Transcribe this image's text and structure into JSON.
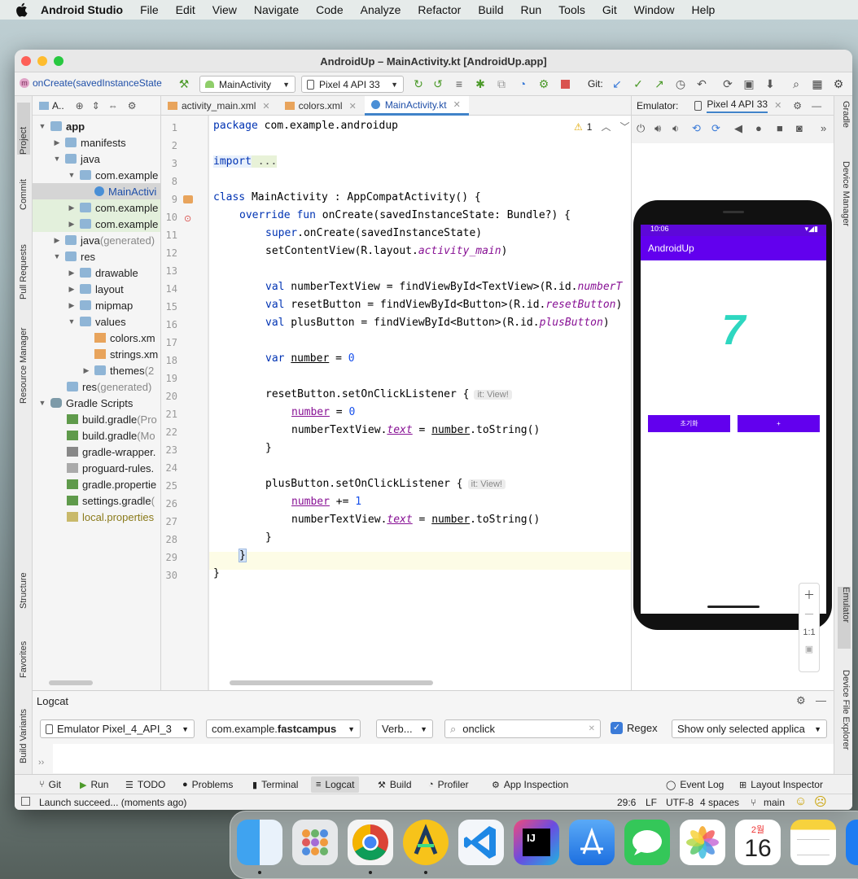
{
  "menubar": {
    "app_name": "Android Studio",
    "items": [
      "File",
      "Edit",
      "View",
      "Navigate",
      "Code",
      "Analyze",
      "Refactor",
      "Build",
      "Run",
      "Tools",
      "Git",
      "Window",
      "Help"
    ]
  },
  "window": {
    "title": "AndroidUp – MainActivity.kt [AndroidUp.app]"
  },
  "toolbar": {
    "breadcrumb": "onCreate(savedInstanceState",
    "run_config": "MainActivity",
    "device": "Pixel 4 API 33",
    "git_label": "Git:"
  },
  "left_stripe": [
    "Project",
    "Commit",
    "Pull Requests",
    "Resource Manager",
    "Structure",
    "Favorites",
    "Build Variants"
  ],
  "right_stripe": [
    "Gradle",
    "Device Manager",
    "Emulator",
    "Device File Explorer"
  ],
  "project": {
    "header": "A..",
    "tree": [
      {
        "label": "app",
        "bold": true
      },
      {
        "label": "manifests"
      },
      {
        "label": "java"
      },
      {
        "label": "com.example"
      },
      {
        "label": "MainActivi"
      },
      {
        "label": "com.example"
      },
      {
        "label": "com.example"
      },
      {
        "label": "java",
        "suffix": " (generated)"
      },
      {
        "label": "res"
      },
      {
        "label": "drawable"
      },
      {
        "label": "layout"
      },
      {
        "label": "mipmap"
      },
      {
        "label": "values"
      },
      {
        "label": "colors.xm"
      },
      {
        "label": "strings.xm"
      },
      {
        "label": "themes",
        "suffix": " (2"
      },
      {
        "label": "res",
        "suffix": " (generated)"
      },
      {
        "label": "Gradle Scripts"
      },
      {
        "label": "build.gradle",
        "suffix": " (Pro"
      },
      {
        "label": "build.gradle",
        "suffix": " (Mo"
      },
      {
        "label": "gradle-wrapper.",
        "suffix": ""
      },
      {
        "label": "proguard-rules.",
        "suffix": ""
      },
      {
        "label": "gradle.propertie",
        "suffix": ""
      },
      {
        "label": "settings.gradle",
        "suffix": " ("
      },
      {
        "label": "local.properties",
        "suffix": ""
      }
    ]
  },
  "editor": {
    "tabs": [
      "activity_main.xml",
      "colors.xml",
      "MainActivity.kt"
    ],
    "active_tab": "MainActivity.kt",
    "warning_count": "1",
    "line_numbers": [
      "1",
      "2",
      "3",
      "8",
      "9",
      "10",
      "11",
      "12",
      "13",
      "14",
      "15",
      "16",
      "17",
      "18",
      "19",
      "20",
      "21",
      "22",
      "23",
      "24",
      "25",
      "26",
      "27",
      "28",
      "29",
      "30"
    ],
    "hint": "it: View!",
    "code": {
      "l1_kw": "package",
      "l1_rest": " com.example.androidup",
      "l3_kw": "import",
      "l3_rest": " ...",
      "l9_kw": "class",
      "l9_rest": " MainActivity : AppCompatActivity() {",
      "l10_kw": "override fun",
      "l10_rest": " onCreate(savedInstanceState: Bundle?) {",
      "l11_kw": "super",
      "l11_rest": ".onCreate(savedInstanceState)",
      "l12_a": "setContentView(R.layout.",
      "l12_b": "activity_main",
      "l12_c": ")",
      "l14_kw": "val",
      "l14_a": " numberTextView = findViewById<TextView>(R.id.",
      "l14_b": "numberT",
      "l15_kw": "val",
      "l15_a": " resetButton = findViewById<Button>(R.id.",
      "l15_b": "resetButton",
      "l15_c": ")",
      "l16_kw": "val",
      "l16_a": " plusButton = findViewById<Button>(R.id.",
      "l16_b": "plusButton",
      "l16_c": ")",
      "l18_kw": "var",
      "l18_a": " ",
      "l18_b": "number",
      "l18_c": " = ",
      "l18_d": "0",
      "l20": "resetButton.setOnClickListener {",
      "l21_a": "number",
      "l21_b": " = ",
      "l21_c": "0",
      "l22_a": "numberTextView.",
      "l22_b": "text",
      "l22_c": " = ",
      "l22_d": "number",
      "l22_e": ".toString()",
      "l23": "}",
      "l25": "plusButton.setOnClickListener {",
      "l26_a": "number",
      "l26_b": " += ",
      "l26_c": "1",
      "l27_a": "numberTextView.",
      "l27_b": "text",
      "l27_c": " = ",
      "l27_d": "number",
      "l27_e": ".toString()",
      "l28": "}",
      "l29": "}",
      "l30": "}"
    }
  },
  "emulator": {
    "title": "Emulator:",
    "device_tab": "Pixel 4 API 33",
    "status_time": "10:06",
    "app_title": "AndroidUp",
    "number": "7",
    "reset_button": "초기화",
    "plus_button": "+",
    "zoom_ratio": "1:1"
  },
  "logcat": {
    "title": "Logcat",
    "device": "Emulator Pixel_4_API_3",
    "package_prefix": "com.example.",
    "package_bold": "fastcampus",
    "level": "Verb...",
    "search": "onclick",
    "regex_label": "Regex",
    "regex_checked": true,
    "filter": "Show only selected applica"
  },
  "bottom_tools": [
    "Git",
    "Run",
    "TODO",
    "Problems",
    "Terminal",
    "Logcat",
    "Build",
    "Profiler",
    "App Inspection",
    "Event Log",
    "Layout Inspector"
  ],
  "status": {
    "message": "Launch succeed... (moments ago)",
    "position": "29:6",
    "line_sep": "LF",
    "encoding": "UTF-8",
    "indent": "4 spaces",
    "branch": "main"
  },
  "dock": {
    "calendar_month": "2월",
    "calendar_day": "16"
  },
  "colors": {
    "accent": "#6200ee",
    "number": "#2ed7c0",
    "tab_underline": "#4083c9"
  }
}
